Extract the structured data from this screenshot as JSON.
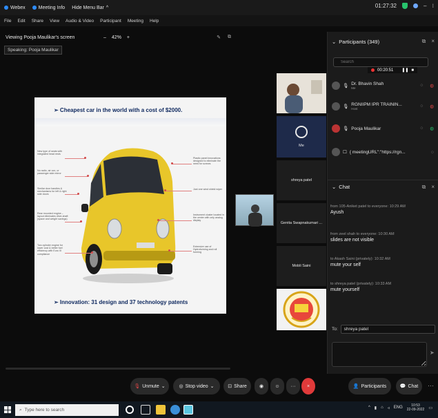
{
  "titlebar": {
    "app": "Webex",
    "meeting_info": "Meeting Info",
    "menu_bar": "Hide Menu Bar",
    "time": "01:27:32"
  },
  "menu": [
    "File",
    "Edit",
    "Share",
    "View",
    "Audio & Video",
    "Participant",
    "Meeting",
    "Help"
  ],
  "share": {
    "viewing": "Viewing Pooja Maulikar's screen",
    "zoom": "42%",
    "speaking_label": "Speaking:",
    "speaking_name": "Pooja Maulikar"
  },
  "slide": {
    "title": "➢ Cheapest car in the world with a cost of $2000.",
    "footer": "➢ Innovation: 31 design and 37 technology patents",
    "left_notes": [
      "New type of seats with integrated head rests",
      "No radio, air con, or passenger side mirror",
      "Similar door handles & mechanisms for left & right side doors",
      "Rear mounted engine – layout eliminates drive-shaft (space and weight savings)",
      "Two cylinder engine for lower cost & better fuel efficiency with Euro III compliance"
    ],
    "right_notes": [
      "Plastic panel innovations designed to eliminate the need for screws",
      "Just one wind shield wiper",
      "Instrument cluster located in the center with only analog display",
      "Extensive use of Hydroforming and roll forming"
    ]
  },
  "video_tiles": [
    {
      "name": ""
    },
    {
      "name": "Me"
    },
    {
      "name": "shreya patel"
    },
    {
      "name": "Genita Swapnakumari ..."
    },
    {
      "name": "Mobli Saini"
    }
  ],
  "participants": {
    "header": "Participants (349)",
    "search_placeholder": "Search",
    "recording_time": "00:20:51",
    "rows": [
      {
        "name": "Dr. Bhavin Shah",
        "role": "Me"
      },
      {
        "name": "RGNIIPM IPR TRAININ...",
        "role": "Host"
      },
      {
        "name": "Pooja Maulikar",
        "role": ""
      },
      {
        "name": "{ meetingURL\":\"https://rgn...",
        "role": ""
      }
    ]
  },
  "chat": {
    "header": "Chat",
    "messages": [
      {
        "meta": "from 105-Aniket patel to everyone:  10:29 AM",
        "text": "Ayush"
      },
      {
        "meta": "from zeel shah to everyone:  10:30 AM",
        "text": "slides are not visible"
      },
      {
        "meta": "to Akash Saini (privately):  10:32 AM",
        "text": "mute your self"
      },
      {
        "meta": "to shreya patel (privately):  10:33 AM",
        "text": "mute yourself"
      }
    ],
    "to_label": "To:",
    "to_value": "shreya patel"
  },
  "toolbar": {
    "unmute": "Unmute",
    "stop_video": "Stop video",
    "share": "Share",
    "participants": "Participants",
    "chat": "Chat"
  },
  "taskbar": {
    "search_placeholder": "Type here to search",
    "time": "10:53",
    "date": "22-09-2022",
    "lang": "ENG"
  }
}
